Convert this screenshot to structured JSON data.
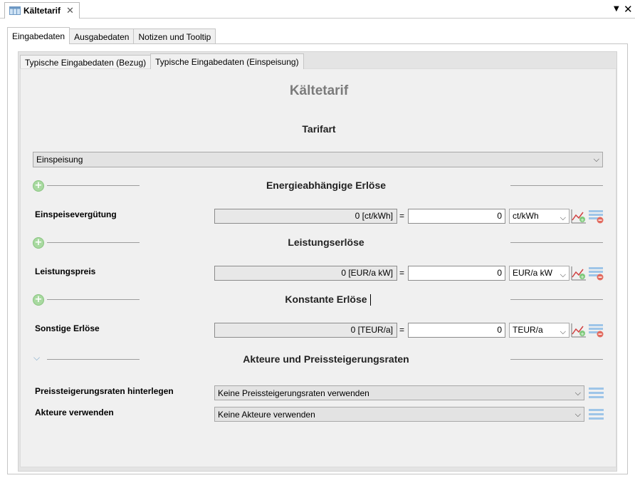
{
  "editor_tab": {
    "label": "Kältetarif",
    "close": "✕"
  },
  "window_controls": {
    "menu": "▼",
    "close": "✕"
  },
  "outer_tabs": [
    "Eingabedaten",
    "Ausgabedaten",
    "Notizen und Tooltip"
  ],
  "inner_tabs": [
    "Typische Eingabedaten (Bezug)",
    "Typische Eingabedaten (Einspeisung)"
  ],
  "form": {
    "title": "Kältetarif",
    "tarifart_label": "Tarifart",
    "tarifart_value": "Einspeisung",
    "sections": {
      "energy": "Energieabhängige Erlöse",
      "power": "Leistungserlöse",
      "constant": "Konstante Erlöse",
      "actors": "Akteure und Preissteigerungsraten"
    },
    "rows": [
      {
        "label": "Einspeisevergütung",
        "readonly": "0 [ct/kWh]",
        "eq": "=",
        "value": "0",
        "unit": "ct/kWh"
      },
      {
        "label": "Leistungspreis",
        "readonly": "0 [EUR/a kW]",
        "eq": "=",
        "value": "0",
        "unit": "EUR/a kW"
      },
      {
        "label": "Sonstige Erlöse",
        "readonly": "0 [TEUR/a]",
        "eq": "=",
        "value": "0",
        "unit": "TEUR/a"
      }
    ],
    "price_rates": {
      "label": "Preissteigerungsraten hinterlegen",
      "value": "Keine Preissteigerungsraten verwenden"
    },
    "actors": {
      "label": "Akteure verwenden",
      "value": "Keine Akteure verwenden"
    }
  },
  "colors": {
    "accent_green": "#a8d9a0",
    "link_blue": "#7aa6c8",
    "title_gray": "#7b7b7b"
  }
}
